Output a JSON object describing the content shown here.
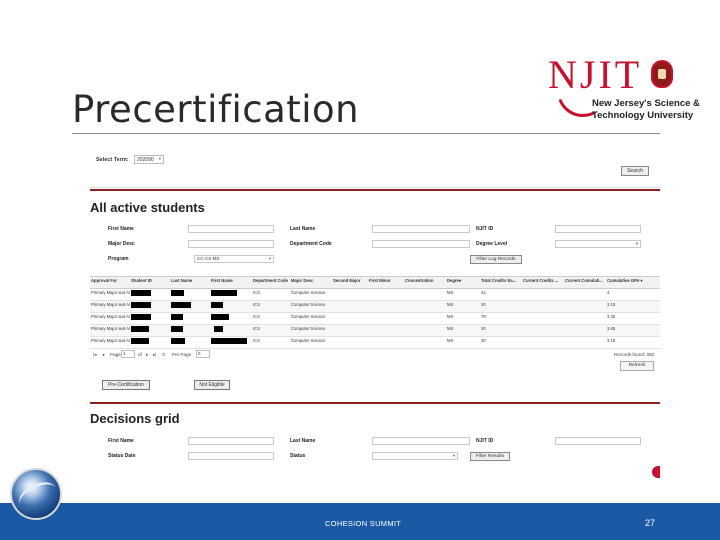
{
  "slide": {
    "title": "Precertification",
    "footer_text": "COHESION SUMMIT",
    "page_number": "27"
  },
  "logo": {
    "mark": "NJIT",
    "tagline_1": "New Jersey's Science &",
    "tagline_2": "Technology University"
  },
  "screen": {
    "select_term_label": "Select Term:",
    "select_term_value": "202090",
    "search_button": "Search",
    "active_section_title": "All active students",
    "active_filters": {
      "first_name_label": "First Name",
      "last_name_label": "Last Name",
      "njit_id_label": "NJIT ID",
      "major_desc_label": "Major Desc",
      "department_code_label": "Department Code",
      "degree_level_label": "Degree Level",
      "program_label": "Program",
      "program_value": "CC-CS-MS",
      "filter_button": "Filter Log Records"
    },
    "grid": {
      "columns": [
        "Approval For",
        "Student ID",
        "Last Name",
        "First Name",
        "Department Code",
        "Major Desc",
        "Second Major",
        "First Minor",
        "Concentration",
        "Degree",
        "Total Credits Ea...",
        "Current Credits ...",
        "Current Cumulati...",
        "Cumulative GPA"
      ],
      "rows": [
        {
          "approval": "Primary Major and ACL-G",
          "dept": "ICS",
          "major": "Computer Science",
          "degree": "MS",
          "credits": "42",
          "gpa": "4"
        },
        {
          "approval": "Primary Major and ACL-G",
          "dept": "ICS",
          "major": "Computer Science",
          "degree": "MS",
          "credits": "30",
          "gpa": "3.15"
        },
        {
          "approval": "Primary Major and ACL-G",
          "dept": "ICS",
          "major": "Computer Science",
          "degree": "MS",
          "credits": "79",
          "gpa": "3.32"
        },
        {
          "approval": "Primary Major and ACL-G",
          "dept": "ICS",
          "major": "Computer Science",
          "degree": "MS",
          "credits": "30",
          "gpa": "3.65"
        },
        {
          "approval": "Primary Major and ACL-G",
          "dept": "ICS",
          "major": "Computer Science",
          "degree": "MS",
          "credits": "30",
          "gpa": "3.15"
        }
      ],
      "pager_page_label": "Page",
      "pager_page_value": "1",
      "pager_of": "of",
      "pager_per_page": "Per Page",
      "pager_per_page_value": "5",
      "records_found": "Records found: 392",
      "refresh_button": "Refresh"
    },
    "precert_button": "Pre-Certification",
    "not_eligible_button": "Not Eligible",
    "decisions_section_title": "Decisions grid",
    "decision_filters": {
      "first_name_label": "First Name",
      "last_name_label": "Last Name",
      "njit_id_label": "NJIT ID",
      "status_date_label": "Status Date",
      "status_label": "Status",
      "filter_button": "Filter Results"
    }
  },
  "colors": {
    "footer": "#1a5aa5",
    "brand_red": "#c8102e",
    "section_rule": "#8b2020"
  }
}
